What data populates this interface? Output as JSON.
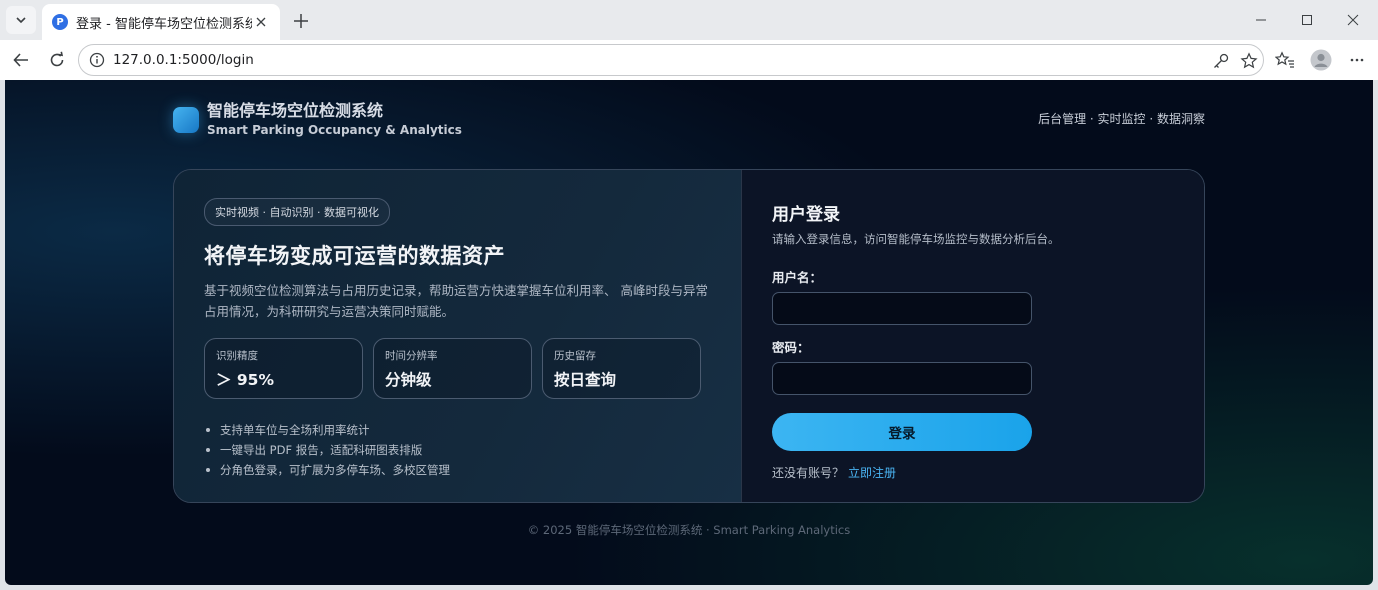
{
  "browser": {
    "tab_title": "登录 - 智能停车场空位检测系统",
    "favicon_letter": "P",
    "url": "127.0.0.1:5000/login"
  },
  "brand": {
    "title": "智能停车场空位检测系统",
    "subtitle": "Smart Parking Occupancy & Analytics"
  },
  "topnav": "后台管理 · 实时监控 · 数据洞察",
  "hero": {
    "badge": "实时视频 · 自动识别 · 数据可视化",
    "headline": "将停车场变成可运营的数据资产",
    "description": "基于视频空位检测算法与占用历史记录，帮助运营方快速掌握车位利用率、 高峰时段与异常占用情况，为科研研究与运营决策同时赋能。",
    "stats": [
      {
        "label": "识别精度",
        "value": "＞ 95%"
      },
      {
        "label": "时间分辨率",
        "value": "分钟级"
      },
      {
        "label": "历史留存",
        "value": "按日查询"
      }
    ],
    "features": [
      "支持单车位与全场利用率统计",
      "一键导出 PDF 报告，适配科研图表排版",
      "分角色登录，可扩展为多停车场、多校区管理"
    ]
  },
  "login": {
    "title": "用户登录",
    "subtitle": "请输入登录信息，访问智能停车场监控与数据分析后台。",
    "username_label": "用户名：",
    "username_value": "",
    "password_label": "密码：",
    "password_value": "",
    "submit_label": "登录",
    "register_prompt": "还没有账号？",
    "register_link": "立即注册"
  },
  "footer": "© 2025 智能停车场空位检测系统 · Smart Parking Analytics",
  "colors": {
    "accent": "#1aa3ea",
    "link": "#4ab4f3",
    "background": "#030b1b"
  }
}
